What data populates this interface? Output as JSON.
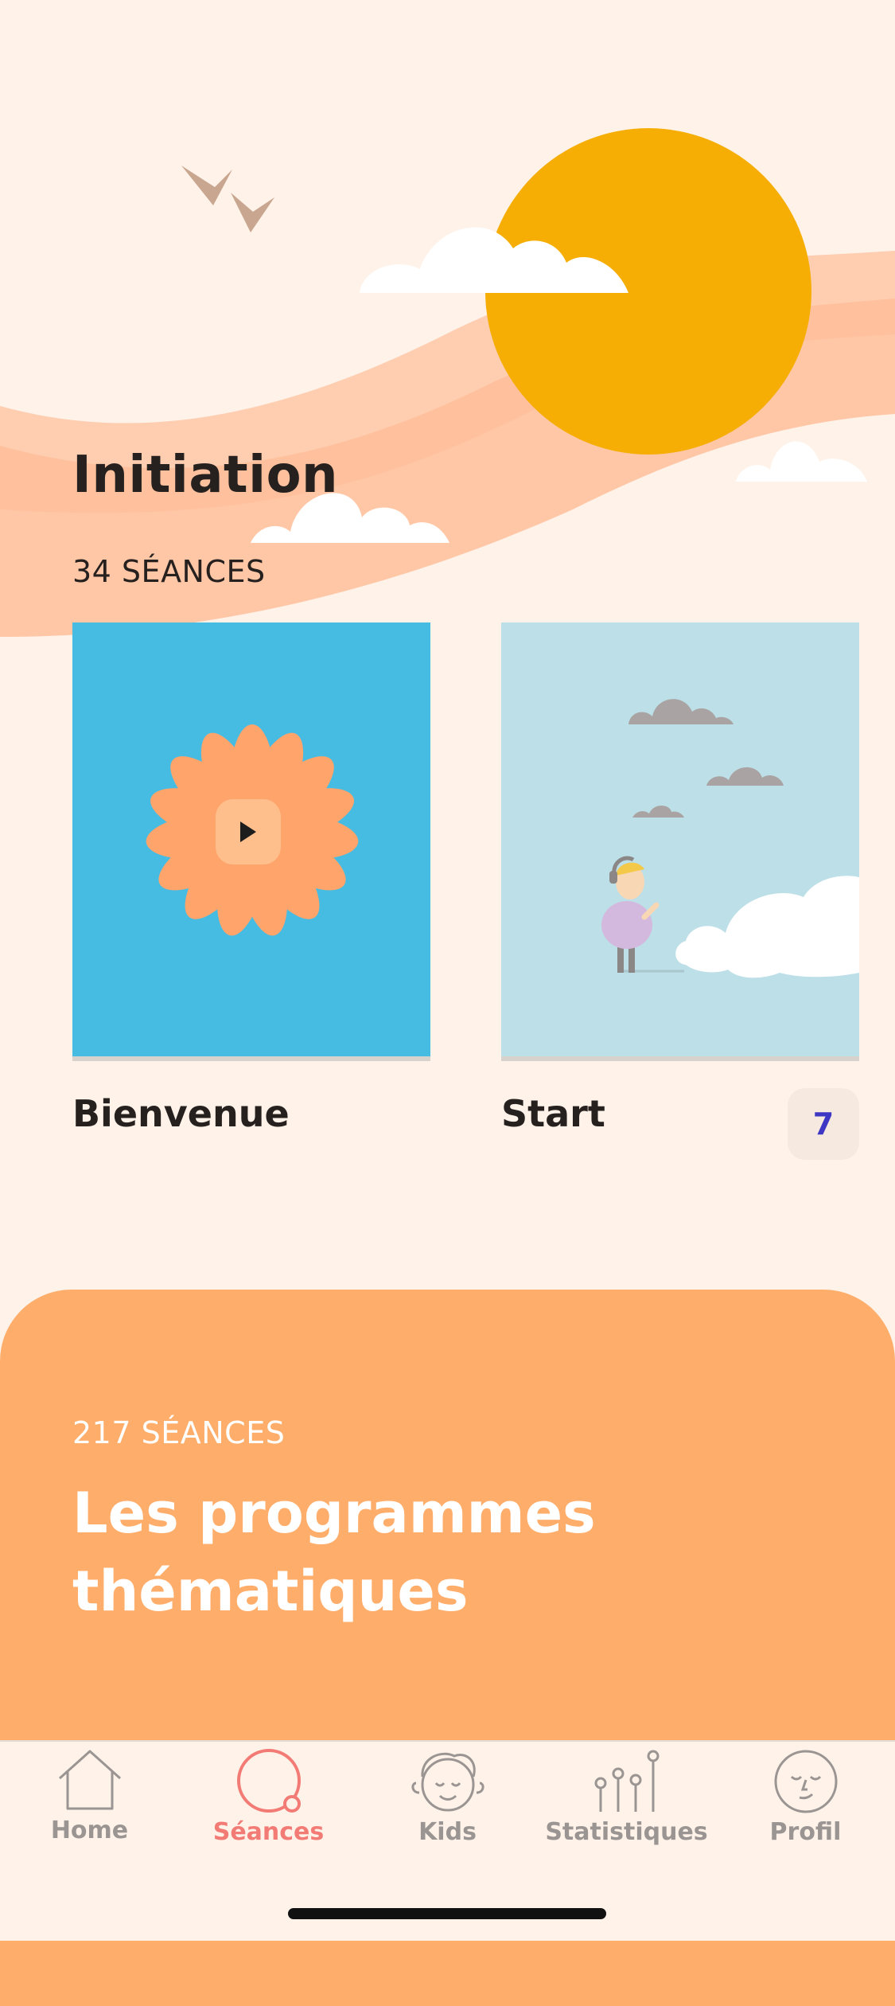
{
  "section": {
    "title": "Initiation",
    "count": "34 SÉANCES"
  },
  "cards": [
    {
      "title": "Bienvenue"
    },
    {
      "title": "Start",
      "badge": "7"
    }
  ],
  "programs": {
    "count": "217 SÉANCES",
    "title": "Les programmes thématiques"
  },
  "tabs": [
    {
      "label": "Home",
      "icon": "house-icon"
    },
    {
      "label": "Séances",
      "icon": "circle-icon",
      "active": true
    },
    {
      "label": "Kids",
      "icon": "kid-face-icon"
    },
    {
      "label": "Statistiques",
      "icon": "stats-icon"
    },
    {
      "label": "Profil",
      "icon": "face-icon"
    }
  ],
  "colors": {
    "background": "#FEF2E9",
    "accent": "#F27C75",
    "sun": "#F6AE05",
    "panel": "#FFAD6A",
    "card_blue": "#46BCE2",
    "card_light_blue": "#BCDFE8",
    "badge_text": "#3E37C4"
  }
}
